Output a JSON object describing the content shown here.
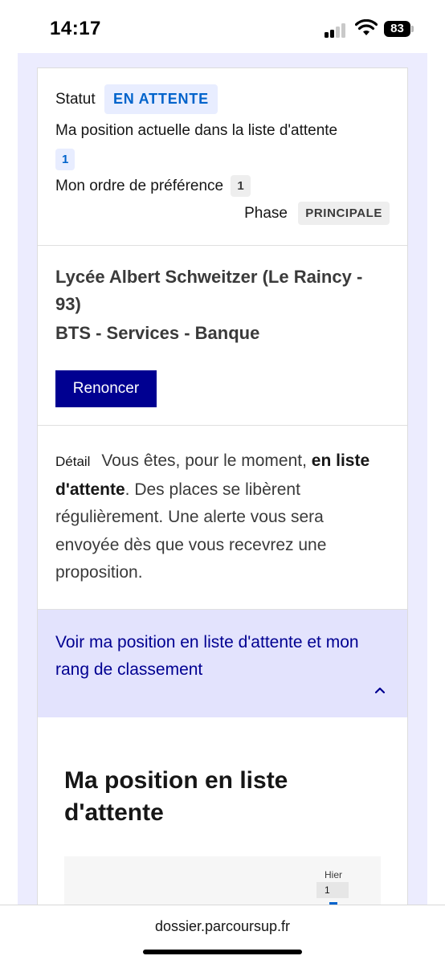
{
  "status_bar": {
    "time": "14:17",
    "battery": "83",
    "icons": [
      "cellular-signal-icon",
      "wifi-icon",
      "battery-icon"
    ]
  },
  "voeu": {
    "status_label": "Statut",
    "status_value": "EN ATTENTE",
    "position_label": "Ma position actuelle dans la liste d'attente",
    "position_value": "1",
    "preference_label": "Mon ordre de préférence",
    "preference_value": "1",
    "phase_label": "Phase",
    "phase_value": "PRINCIPALE"
  },
  "school": {
    "name": "Lycée Albert Schweitzer (Le Raincy - 93)",
    "formation": "BTS - Services - Banque",
    "renounce_button": "Renoncer"
  },
  "detail": {
    "label": "Détail",
    "text_before": "Vous êtes, pour le moment,",
    "text_bold": "en liste d'attente",
    "text_after": ". Des places se libèrent régulièrement. Une alerte vous sera envoyée dès que vous recevrez une proposition."
  },
  "accordion": {
    "title": "Voir ma position en liste d'attente et mon rang de classement",
    "expanded": true
  },
  "position_panel": {
    "title": "Ma position en liste d'attente",
    "column_label": "Hier",
    "column_value": "1"
  },
  "browser": {
    "url": "dossier.parcoursup.fr"
  },
  "colors": {
    "primary": "#000091",
    "info_text": "#0063cb",
    "info_bg": "#e8edff",
    "accordion_bg": "#e3e3fd",
    "page_bg": "#ececfe"
  }
}
